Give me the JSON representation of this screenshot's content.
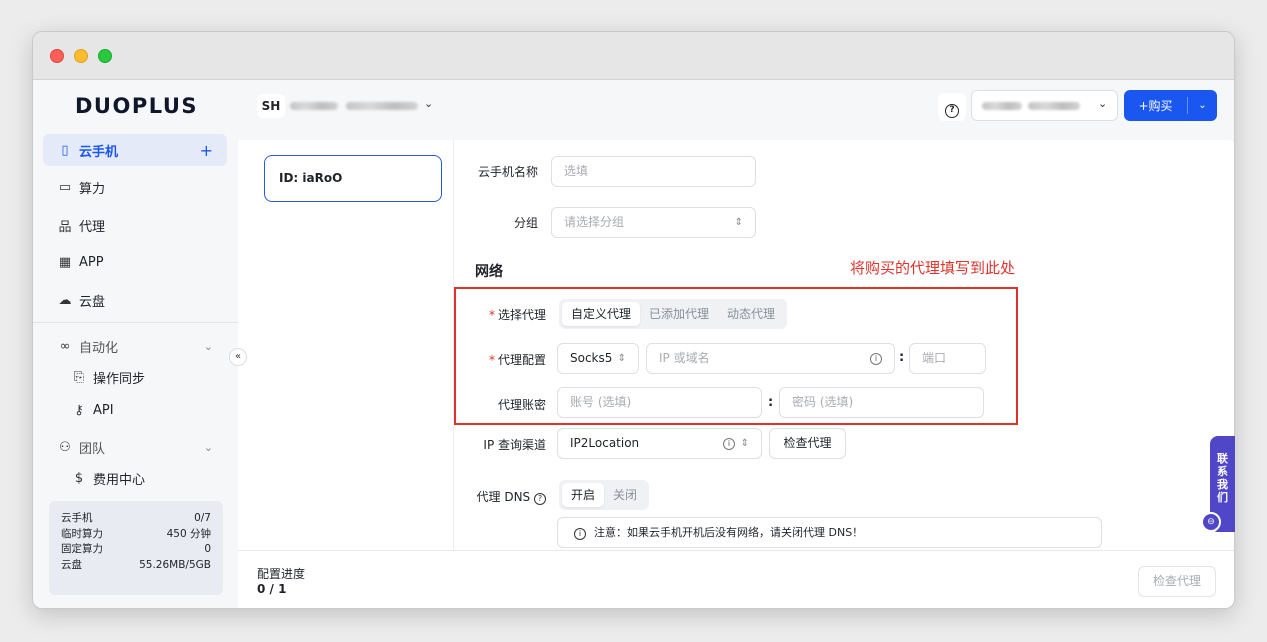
{
  "app": {
    "logo": "DUOPLUS"
  },
  "sidebar": {
    "items": [
      {
        "icon": "phone-icon",
        "glyph": "▯",
        "label": "云手机",
        "plus": "+"
      },
      {
        "icon": "compute-icon",
        "glyph": "▭",
        "label": "算力"
      },
      {
        "icon": "proxy-icon",
        "glyph": "品",
        "label": "代理"
      },
      {
        "icon": "app-grid-icon",
        "glyph": "▦",
        "label": "APP"
      },
      {
        "icon": "cloud-icon",
        "glyph": "☁",
        "label": "云盘"
      },
      {
        "icon": "infinity-icon",
        "glyph": "∞",
        "label": "自动化"
      },
      {
        "icon": "sync-icon",
        "glyph": "⎘",
        "label": "操作同步"
      },
      {
        "icon": "api-icon",
        "glyph": "⚷",
        "label": "API"
      },
      {
        "icon": "team-icon",
        "glyph": "⚇",
        "label": "团队"
      },
      {
        "icon": "dollar-icon",
        "glyph": "$",
        "label": "费用中心"
      }
    ],
    "stats": [
      {
        "label": "云手机",
        "value": "0/7"
      },
      {
        "label": "临时算力",
        "value": "450 分钟"
      },
      {
        "label": "固定算力",
        "value": "0"
      },
      {
        "label": "云盘",
        "value": "55.26MB/5GB"
      }
    ]
  },
  "topbar": {
    "team_badge": "SH",
    "buy_label": "+购买"
  },
  "device_list": {
    "selected_id": "ID: iaRoO"
  },
  "form": {
    "name_label": "云手机名称",
    "name_placeholder": "选填",
    "group_label": "分组",
    "group_placeholder": "请选择分组",
    "network_title": "网络",
    "annotation": "将购买的代理填写到此处",
    "proxy_select_label": "选择代理",
    "proxy_tabs": [
      "自定义代理",
      "已添加代理",
      "动态代理"
    ],
    "proxy_config_label": "代理配置",
    "protocol_value": "Socks5",
    "host_placeholder": "IP 或域名",
    "port_placeholder": "端口",
    "account_label": "代理账密",
    "account_placeholder": "账号 (选填)",
    "password_placeholder": "密码 (选填)",
    "ip_channel_label": "IP 查询渠道",
    "ip_channel_value": "IP2Location",
    "check_proxy_label": "检查代理",
    "dns_label": "代理 DNS",
    "dns_on": "开启",
    "dns_off": "关闭",
    "notice": "注意：如果云手机开机后没有网络，请关闭代理 DNS！"
  },
  "footer": {
    "progress_label": "配置进度",
    "progress_value": "0 / 1",
    "check_button": "检查代理"
  },
  "contact": {
    "label": "联系我们"
  }
}
